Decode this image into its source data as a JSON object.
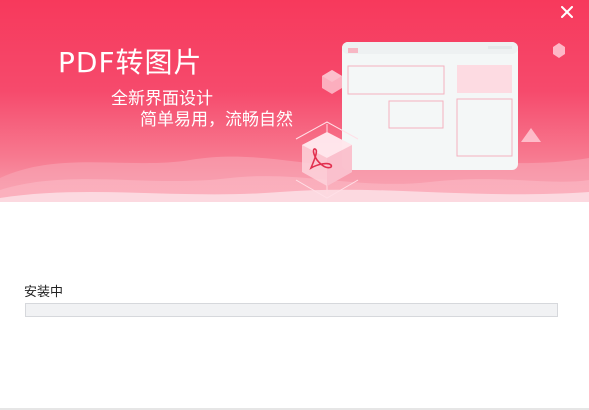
{
  "banner": {
    "title": "PDF转图片",
    "subtitle_line1": "全新界面设计",
    "subtitle_line2": "简单易用，流畅自然"
  },
  "window_controls": {
    "close_icon": "close-icon"
  },
  "install": {
    "status_text": "安装中",
    "progress_fraction": 0
  },
  "colors": {
    "brand": "#f54a6a",
    "banner_top": "#f7395c",
    "banner_bottom": "#f8a3b1",
    "track": "#f1f2f4"
  }
}
